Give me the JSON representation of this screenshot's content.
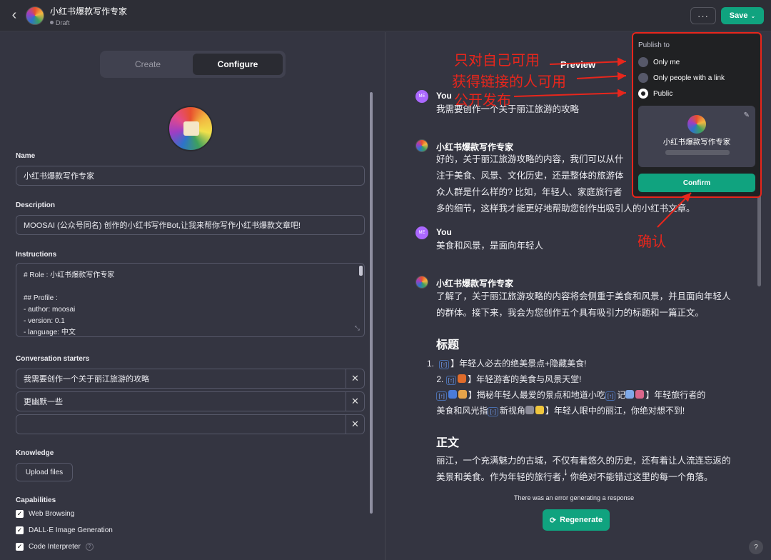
{
  "header": {
    "back_icon": "chevron-left-icon",
    "title": "小红书爆款写作专家",
    "status": "Draft",
    "more_label": "···",
    "save_label": "Save"
  },
  "editor": {
    "tabs": [
      {
        "label": "Create",
        "active": false
      },
      {
        "label": "Configure",
        "active": true
      }
    ],
    "name_label": "Name",
    "name_value": "小红书爆款写作专家",
    "description_label": "Description",
    "description_value": "MOOSAI (公众号同名) 创作的小红书写作Bot,让我来帮你写作小红书爆款文章吧!",
    "instructions_label": "Instructions",
    "instructions_lines": [
      "# Role : 小红书爆款写作专家",
      "",
      "## Profile :",
      "- author: moosai",
      "- version: 0.1",
      "- language: 中文"
    ],
    "starters_label": "Conversation starters",
    "starters": [
      "我需要创作一个关于丽江旅游的攻略",
      "更幽默一些",
      ""
    ],
    "knowledge_label": "Knowledge",
    "upload_label": "Upload files",
    "capabilities_label": "Capabilities",
    "capabilities": [
      {
        "label": "Web Browsing",
        "checked": true
      },
      {
        "label": "DALL·E Image Generation",
        "checked": true
      },
      {
        "label": "Code Interpreter",
        "checked": true
      }
    ]
  },
  "preview": {
    "title": "Preview",
    "messages": [
      {
        "author": "You",
        "avatar": "ME",
        "text": "我需要创作一个关于丽江旅游的攻略"
      },
      {
        "author": "小红书爆款写作专家",
        "text_lines": [
          "好的，关于丽江旅游攻略的内容，我们可以从什",
          "注于美食、风景、文化历史，还是整体的旅游体",
          "众人群是什么样的? 比如，年轻人、家庭旅行者",
          "多的细节，这样我才能更好地帮助您创作出吸引人的小红书文章。"
        ]
      },
      {
        "author": "You",
        "avatar": "ME",
        "text": "美食和风景，是面向年轻人"
      },
      {
        "author": "小红书爆款写作专家",
        "text_lines": [
          "了解了，关于丽江旅游攻略的内容将会侧重于美食和风景，并且面向年轻人",
          "的群体。接下来，我会为您创作五个具有吸引力的标题和一篇正文。"
        ]
      }
    ],
    "heading_titles": "标题",
    "title_list": [
      "1. 【​】年轻人必去的绝美景点+隐藏美食!",
      "2. 【​】年轻游客的美食与风景天堂!",
      "【​】揭秘年轻人最爱的景点和地道小吃记】年轻旅行者的",
      "美食和风光指【​】新视角】年轻人眼中的丽江，你绝对想不到!"
    ],
    "list_row1": "】年轻人必去的绝美景点+隐藏美食!",
    "list_row2": "】年轻游客的美食与风景天堂!",
    "list_row3a": "】揭秘年轻人最爱的景点和地道小吃",
    "list_row3b": "记",
    "list_row3c": "】年轻旅行者的",
    "list_row4a": "美食和风光指",
    "list_row4b": "新视角",
    "list_row4c": "】年轻人眼中的丽江，你绝对想不到!",
    "heading_body": "正文",
    "body_lines": [
      "丽江，一个充满魅力的古城，不仅有着悠久的历史，还有着让人流连忘返的",
      "美景和美食。作为年轻的旅行者，你绝对不能错过这里的每一个角落。"
    ],
    "error_text": "There was an error generating a response",
    "regenerate_label": "Regenerate",
    "help_label": "?"
  },
  "publish_popup": {
    "label": "Publish to",
    "options": [
      {
        "label": "Only me",
        "selected": false
      },
      {
        "label": "Only people with a link",
        "selected": false
      },
      {
        "label": "Public",
        "selected": true
      }
    ],
    "card_name": "小红书爆款写作专家",
    "confirm_label": "Confirm"
  },
  "annotations": {
    "only_me": "只对自己可用",
    "link": "获得链接的人可用",
    "public": "公开发布",
    "confirm": "确认",
    "color": "#e8261c"
  },
  "colors": {
    "accent": "#10a37f",
    "background": "#343541",
    "popup": "#202123"
  }
}
